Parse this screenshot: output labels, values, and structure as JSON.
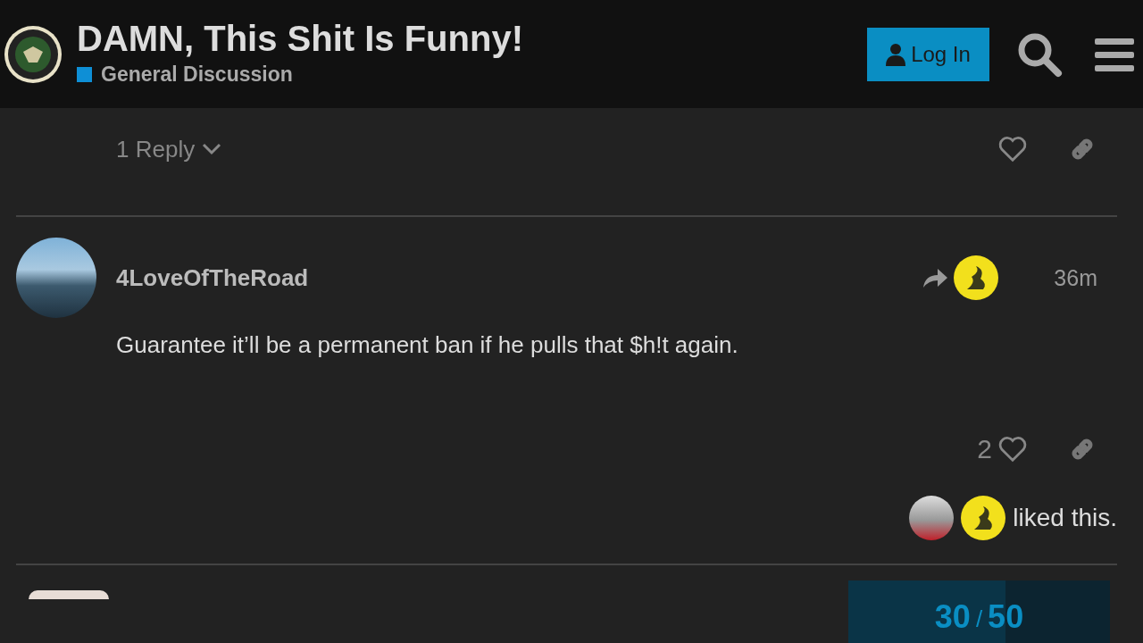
{
  "header": {
    "title": "DAMN, This Shit Is Funny!",
    "category": {
      "name": "General Discussion",
      "color": "#0e8fd6"
    },
    "login_button": "Log In"
  },
  "previous_post": {
    "replies": "1 Reply"
  },
  "post": {
    "username": "4LoveOfTheRoad",
    "time": "36m",
    "body": "Guarantee it’ll be a permanent ban if he pulls that $h!t again.",
    "like_count": "2",
    "liked_by_text": "liked this."
  },
  "timeline": {
    "current": "30",
    "separator": "/",
    "total": "50",
    "level": 0.6
  }
}
